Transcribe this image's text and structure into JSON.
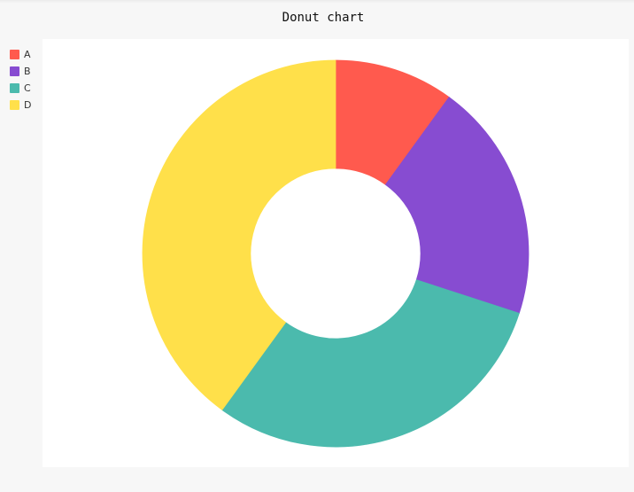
{
  "chart_data": {
    "type": "pie",
    "title": "Donut chart",
    "donut": true,
    "legend_position": "top-left",
    "categories": [
      "A",
      "B",
      "C",
      "D"
    ],
    "values": [
      10,
      20,
      30,
      40
    ],
    "colors": [
      "#ff5a4e",
      "#874cd1",
      "#4bbaad",
      "#ffe04a"
    ]
  }
}
